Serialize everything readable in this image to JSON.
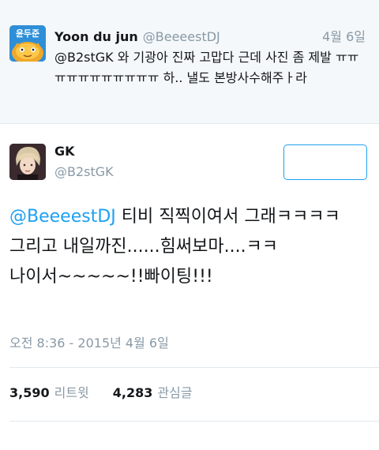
{
  "reply_tweet": {
    "avatar_text": "윤두준",
    "name": "Yoon du jun",
    "handle": "@BeeeestDJ",
    "date": "4월 6일",
    "text": "@B2stGK 와 기광아 진짜 고맙다 근데 사진 좀 제발 ㅠㅠㅠㅠㅠㅠㅠㅠㅠㅠㅠ 하.. 낼도 본방사수해주ㅏ라"
  },
  "main_tweet": {
    "name": "GK",
    "handle": "@B2stGK",
    "mention": "@BeeeestDJ",
    "line1_rest": " 티비 직찍이여서 그래ㅋㅋㅋㅋ",
    "line2": "그리고 내일까진......힘써보마....ㅋㅋ",
    "line3": "나이서~~~~~!!빠이팅!!!",
    "timestamp": "오전 8:36 - 2015년 4월 6일",
    "retweets_count": "3,590",
    "retweets_label": "리트윗",
    "likes_count": "4,283",
    "likes_label": "관심글"
  },
  "colors": {
    "accent": "#1da1f2",
    "secondary_text": "#8899a6",
    "reply_background": "#f5f8fa"
  }
}
